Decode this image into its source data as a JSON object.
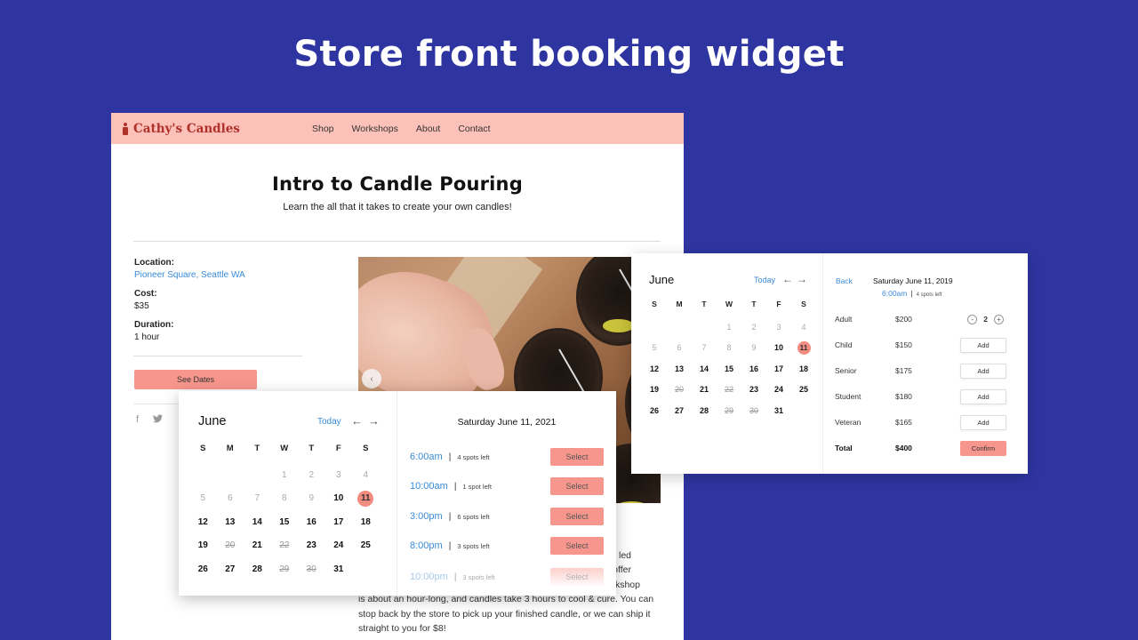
{
  "slide": {
    "title": "Store front booking widget"
  },
  "site": {
    "brand": "Cathy's Candles",
    "nav": [
      "Shop",
      "Workshops",
      "About",
      "Contact"
    ],
    "title": "Intro to Candle Pouring",
    "subtitle": "Learn the all that it takes to create your own candles!",
    "details": {
      "location_label": "Location:",
      "location_value": "Pioneer Square, Seattle WA",
      "cost_label": "Cost:",
      "cost_value": "$35",
      "duration_label": "Duration:",
      "duration_value": "1 hour"
    },
    "see_dates_label": "See Dates",
    "social": [
      "facebook-icon",
      "twitter-icon"
    ],
    "photo_prev_icon": "‹",
    "body_fragments": [
      "eing led",
      "to offer",
      "workshop"
    ],
    "body_lines": [
      "is about an hour-long, and candles take 3 hours to cool & cure. You can",
      "stop back by the store to pick up your finished candle, or we can ship it",
      "straight to you for $8!"
    ]
  },
  "calendar": {
    "month": "June",
    "today_label": "Today",
    "prev_icon": "←",
    "next_icon": "→",
    "weekdays": [
      "S",
      "M",
      "T",
      "W",
      "T",
      "F",
      "S"
    ],
    "leading_blanks": 3,
    "days": [
      {
        "n": "1",
        "state": "past"
      },
      {
        "n": "2",
        "state": "past"
      },
      {
        "n": "3",
        "state": "past"
      },
      {
        "n": "4",
        "state": "past"
      },
      {
        "n": "5",
        "state": "past"
      },
      {
        "n": "6",
        "state": "past"
      },
      {
        "n": "7",
        "state": "past"
      },
      {
        "n": "8",
        "state": "past"
      },
      {
        "n": "9",
        "state": "past"
      },
      {
        "n": "10",
        "state": "available"
      },
      {
        "n": "11",
        "state": "selected"
      },
      {
        "n": "12",
        "state": "available"
      },
      {
        "n": "13",
        "state": "available"
      },
      {
        "n": "14",
        "state": "available"
      },
      {
        "n": "15",
        "state": "available"
      },
      {
        "n": "16",
        "state": "available"
      },
      {
        "n": "17",
        "state": "available"
      },
      {
        "n": "18",
        "state": "available"
      },
      {
        "n": "19",
        "state": "available"
      },
      {
        "n": "20",
        "state": "full"
      },
      {
        "n": "21",
        "state": "available"
      },
      {
        "n": "22",
        "state": "full"
      },
      {
        "n": "23",
        "state": "available"
      },
      {
        "n": "24",
        "state": "available"
      },
      {
        "n": "25",
        "state": "available"
      },
      {
        "n": "26",
        "state": "available"
      },
      {
        "n": "27",
        "state": "available"
      },
      {
        "n": "28",
        "state": "available"
      },
      {
        "n": "29",
        "state": "full"
      },
      {
        "n": "30",
        "state": "full"
      },
      {
        "n": "31",
        "state": "available"
      }
    ]
  },
  "timeslots": {
    "date": "Saturday June 11, 2021",
    "separator": "|",
    "select_label": "Select",
    "slots": [
      {
        "time": "6:00am",
        "spots": "4 spots left"
      },
      {
        "time": "10:00am",
        "spots": "1 spot left"
      },
      {
        "time": "3:00pm",
        "spots": "6 spots left"
      },
      {
        "time": "8:00pm",
        "spots": "3 spots left"
      },
      {
        "time": "10:00pm",
        "spots": "3 spots left"
      }
    ]
  },
  "tickets": {
    "back_label": "Back",
    "date": "Saturday June 11, 2019",
    "time": "6:00am",
    "separator": "|",
    "spots": "4 spots left",
    "add_label": "Add",
    "minus": "-",
    "plus": "+",
    "rows": [
      {
        "name": "Adult",
        "price": "$200",
        "qty": "2"
      },
      {
        "name": "Child",
        "price": "$150"
      },
      {
        "name": "Senior",
        "price": "$175"
      },
      {
        "name": "Student",
        "price": "$180"
      },
      {
        "name": "Veteran",
        "price": "$165"
      }
    ],
    "total_label": "Total",
    "total_value": "$400",
    "confirm_label": "Confirm"
  },
  "colors": {
    "background": "#2e35a0",
    "nav_bg": "#fcc1b8",
    "brand": "#b0302a",
    "accent_button": "#f7968d",
    "link": "#3a8ad6",
    "selected_day": "#f28b80"
  }
}
